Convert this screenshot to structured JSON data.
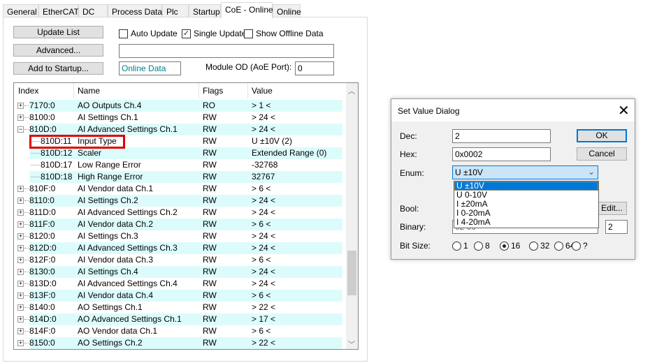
{
  "tabs": [
    "General",
    "EtherCAT",
    "DC",
    "Process Data",
    "Plc",
    "Startup",
    "CoE - Online",
    "Online"
  ],
  "active_tab": "CoE - Online",
  "buttons": {
    "update_list": "Update List",
    "advanced": "Advanced...",
    "add_to_startup": "Add to Startup..."
  },
  "checkboxes": [
    {
      "label": "Auto Update",
      "checked": false
    },
    {
      "label": "Single Update",
      "checked": true
    },
    {
      "label": "Show Offline Data",
      "checked": false
    }
  ],
  "advanced_field": "",
  "online_data": "Online Data",
  "module_od_label": "Module OD (AoE Port):",
  "module_od_value": "0",
  "columns": [
    "Index",
    "Name",
    "Flags",
    "Value"
  ],
  "rows": [
    {
      "index": "7170:0",
      "name": "AO Outputs Ch.4",
      "flags": "RO",
      "value": "> 1 <",
      "level": 0,
      "expander": "+"
    },
    {
      "index": "8100:0",
      "name": "AI Settings Ch.1",
      "flags": "RW",
      "value": "> 24 <",
      "level": 0,
      "expander": "+"
    },
    {
      "index": "810D:0",
      "name": "AI Advanced Settings Ch.1",
      "flags": "RW",
      "value": "> 24 <",
      "level": 0,
      "expander": "-"
    },
    {
      "index": "810D:11",
      "name": "Input Type",
      "flags": "RW",
      "value": "U ±10V (2)",
      "level": 1,
      "expander": ""
    },
    {
      "index": "810D:12",
      "name": "Scaler",
      "flags": "RW",
      "value": "Extended Range (0)",
      "level": 1,
      "expander": ""
    },
    {
      "index": "810D:17",
      "name": "Low Range Error",
      "flags": "RW",
      "value": "-32768",
      "level": 1,
      "expander": ""
    },
    {
      "index": "810D:18",
      "name": "High Range Error",
      "flags": "RW",
      "value": "32767",
      "level": 1,
      "expander": ""
    },
    {
      "index": "810F:0",
      "name": "AI Vendor data Ch.1",
      "flags": "RW",
      "value": "> 6 <",
      "level": 0,
      "expander": "+"
    },
    {
      "index": "8110:0",
      "name": "AI Settings Ch.2",
      "flags": "RW",
      "value": "> 24 <",
      "level": 0,
      "expander": "+"
    },
    {
      "index": "811D:0",
      "name": "AI Advanced Settings Ch.2",
      "flags": "RW",
      "value": "> 24 <",
      "level": 0,
      "expander": "+"
    },
    {
      "index": "811F:0",
      "name": "AI Vendor data Ch.2",
      "flags": "RW",
      "value": "> 6 <",
      "level": 0,
      "expander": "+"
    },
    {
      "index": "8120:0",
      "name": "AI Settings Ch.3",
      "flags": "RW",
      "value": "> 24 <",
      "level": 0,
      "expander": "+"
    },
    {
      "index": "812D:0",
      "name": "AI Advanced Settings Ch.3",
      "flags": "RW",
      "value": "> 24 <",
      "level": 0,
      "expander": "+"
    },
    {
      "index": "812F:0",
      "name": "AI Vendor data Ch.3",
      "flags": "RW",
      "value": "> 6 <",
      "level": 0,
      "expander": "+"
    },
    {
      "index": "8130:0",
      "name": "AI Settings Ch.4",
      "flags": "RW",
      "value": "> 24 <",
      "level": 0,
      "expander": "+"
    },
    {
      "index": "813D:0",
      "name": "AI Advanced Settings Ch.4",
      "flags": "RW",
      "value": "> 24 <",
      "level": 0,
      "expander": "+"
    },
    {
      "index": "813F:0",
      "name": "AI Vendor data Ch.4",
      "flags": "RW",
      "value": "> 6 <",
      "level": 0,
      "expander": "+"
    },
    {
      "index": "8140:0",
      "name": "AO Settings Ch.1",
      "flags": "RW",
      "value": "> 22 <",
      "level": 0,
      "expander": "+"
    },
    {
      "index": "814D:0",
      "name": "AO Advanced Settings Ch.1",
      "flags": "RW",
      "value": "> 17 <",
      "level": 0,
      "expander": "+"
    },
    {
      "index": "814F:0",
      "name": "AO Vendor data Ch.1",
      "flags": "RW",
      "value": "> 6 <",
      "level": 0,
      "expander": "+"
    },
    {
      "index": "8150:0",
      "name": "AO Settings Ch.2",
      "flags": "RW",
      "value": "> 22 <",
      "level": 0,
      "expander": "+"
    }
  ],
  "row_colors": {
    "alt": "#dcfcfc",
    "highlight_box": "#e00000"
  },
  "dialog": {
    "title": "Set Value Dialog",
    "dec_label": "Dec:",
    "dec_value": "2",
    "hex_label": "Hex:",
    "hex_value": "0x0002",
    "enum_label": "Enum:",
    "enum_value": "U ±10V",
    "enum_options": [
      "U ±10V",
      "U 0-10V",
      "I ±20mA",
      "I 0-20mA",
      "I 4-20mA"
    ],
    "bool_label": "Bool:",
    "binary_label": "Binary:",
    "binary_value": "02 00",
    "binary_size": "2",
    "bitsize_label": "Bit Size:",
    "bitsizes": [
      "1",
      "8",
      "16",
      "32",
      "64",
      "?"
    ],
    "bitsize_selected": "16",
    "ok": "OK",
    "cancel": "Cancel",
    "edit": "Edit..."
  }
}
